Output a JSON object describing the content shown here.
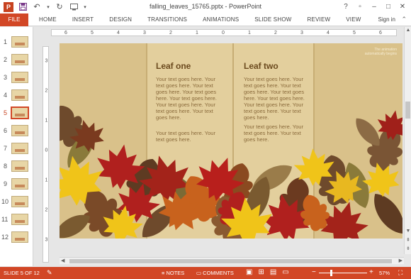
{
  "window": {
    "title": "falling_leaves_15765.pptx - PowerPoint",
    "controls": [
      "?",
      "▫",
      "–",
      "□",
      "✕"
    ]
  },
  "qat": {
    "icons": [
      "powerpoint-logo",
      "save-icon",
      "undo-icon",
      "redo-icon",
      "start-from-beginning-icon",
      "customize-qat-icon"
    ]
  },
  "ribbon": {
    "file": "FILE",
    "tabs": [
      "HOME",
      "INSERT",
      "DESIGN",
      "TRANSITIONS",
      "ANIMATIONS",
      "SLIDE SHOW",
      "REVIEW",
      "VIEW"
    ],
    "signin": "Sign in"
  },
  "thumbnails": {
    "numbers": [
      "1",
      "2",
      "3",
      "4",
      "5",
      "6",
      "7",
      "8",
      "9",
      "10",
      "11",
      "12"
    ],
    "active": "5"
  },
  "ruler": {
    "h_ticks": [
      "6",
      "5",
      "4",
      "3",
      "2",
      "1",
      "0",
      "1",
      "2",
      "3",
      "4",
      "5",
      "6"
    ],
    "v_ticks": [
      "3",
      "2",
      "1",
      "0",
      "1",
      "2",
      "3"
    ]
  },
  "slide": {
    "leaf_one_title": "Leaf one",
    "leaf_one_body_1": "Your text goes here. Your text goes here. Your text goes here. Your text goes here. Your text goes here. Your text goes here. Your text goes here. Your text goes here.",
    "leaf_one_body_2": "Your text goes here. Your text goes here.",
    "leaf_two_title": "Leaf two",
    "leaf_two_body_1": "Your text goes here. Your text goes here. Your text goes here. Your text goes here. Your text goes here. Your text goes here. Your text goes here. Your text goes here.",
    "leaf_two_body_2": "Your text goes here. Your text goes here. Your text goes here.",
    "note": "The animation\nautomatically begins"
  },
  "statusbar": {
    "slide_count": "SLIDE 5 OF 12",
    "notes": "NOTES",
    "comments": "COMMENTS",
    "zoom": "57%"
  },
  "colors": {
    "accent": "#d24726",
    "slide_bg": "#d9c18a",
    "panel": "#e3cf9d",
    "title_text": "#6b4a1e",
    "leaf_red": "#b0201e",
    "leaf_yellow": "#f0c419",
    "leaf_orange": "#c8621d",
    "leaf_brown": "#6e4a2c",
    "leaf_olive": "#8a7a3a"
  }
}
